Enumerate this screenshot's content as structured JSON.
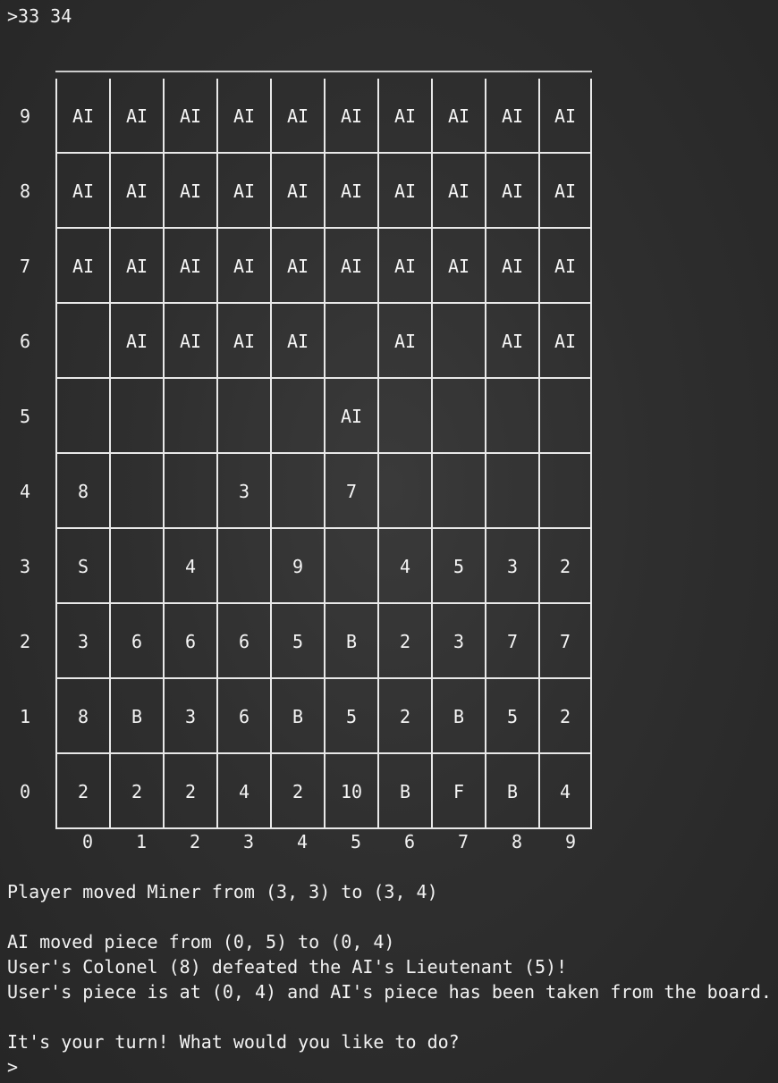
{
  "terminal": {
    "command_line": ">33 34",
    "board": {
      "rows": [
        {
          "label": "9",
          "cells": [
            "AI",
            "AI",
            "AI",
            "AI",
            "AI",
            "AI",
            "AI",
            "AI",
            "AI",
            "AI"
          ]
        },
        {
          "label": "8",
          "cells": [
            "AI",
            "AI",
            "AI",
            "AI",
            "AI",
            "AI",
            "AI",
            "AI",
            "AI",
            "AI"
          ]
        },
        {
          "label": "7",
          "cells": [
            "AI",
            "AI",
            "AI",
            "AI",
            "AI",
            "AI",
            "AI",
            "AI",
            "AI",
            "AI"
          ]
        },
        {
          "label": "6",
          "cells": [
            "",
            "AI",
            "AI",
            "AI",
            "AI",
            "",
            "AI",
            "",
            "AI",
            "AI"
          ]
        },
        {
          "label": "5",
          "cells": [
            "",
            "",
            "",
            "",
            "",
            "AI",
            "",
            "",
            "",
            ""
          ]
        },
        {
          "label": "4",
          "cells": [
            "8",
            "",
            "",
            "3",
            "",
            "7",
            "",
            "",
            "",
            ""
          ]
        },
        {
          "label": "3",
          "cells": [
            "S",
            "",
            "4",
            "",
            "9",
            "",
            "4",
            "5",
            "3",
            "2"
          ]
        },
        {
          "label": "2",
          "cells": [
            "3",
            "6",
            "6",
            "6",
            "5",
            "B",
            "2",
            "3",
            "7",
            "7"
          ]
        },
        {
          "label": "1",
          "cells": [
            "8",
            "B",
            "3",
            "6",
            "B",
            "5",
            "2",
            "B",
            "5",
            "2"
          ]
        },
        {
          "label": "0",
          "cells": [
            "2",
            "2",
            "2",
            "4",
            "2",
            "10",
            "B",
            "F",
            "B",
            "4"
          ]
        }
      ],
      "column_labels": [
        "0",
        "1",
        "2",
        "3",
        "4",
        "5",
        "6",
        "7",
        "8",
        "9"
      ]
    },
    "messages": {
      "player_move": "Player moved Miner from (3, 3) to (3, 4)",
      "ai_move": "AI moved piece from (0, 5) to (0, 4)",
      "battle_result": "User's Colonel (8) defeated the AI's Lieutenant (5)!",
      "battle_outcome": "User's piece is at (0, 4) and AI's piece has been taken from the board.",
      "turn_prompt": "It's your turn! What would you like to do?"
    },
    "input_prompt": ">",
    "input_value": ""
  }
}
